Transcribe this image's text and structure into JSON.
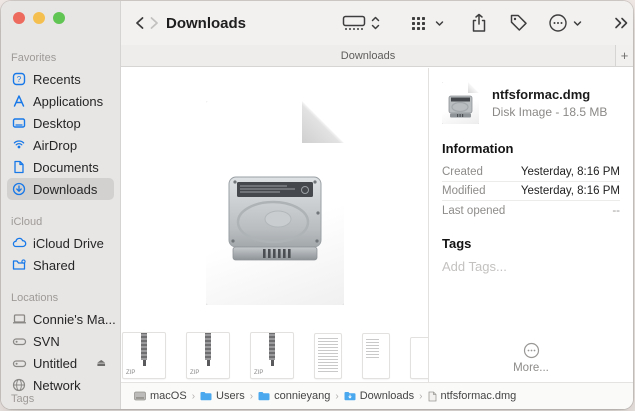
{
  "window": {
    "title": "Downloads"
  },
  "toolbar": {
    "title": "Downloads"
  },
  "tabbar": {
    "tab_label": "Downloads",
    "new_tab_label": "+"
  },
  "sidebar": {
    "sections": [
      {
        "header": "Favorites",
        "items": [
          {
            "label": "Recents",
            "icon": "recents-icon"
          },
          {
            "label": "Applications",
            "icon": "applications-icon"
          },
          {
            "label": "Desktop",
            "icon": "desktop-icon"
          },
          {
            "label": "AirDrop",
            "icon": "airdrop-icon"
          },
          {
            "label": "Documents",
            "icon": "documents-icon"
          },
          {
            "label": "Downloads",
            "icon": "downloads-icon",
            "selected": true
          }
        ]
      },
      {
        "header": "iCloud",
        "items": [
          {
            "label": "iCloud Drive",
            "icon": "icloud-icon"
          },
          {
            "label": "Shared",
            "icon": "shared-folder-icon"
          }
        ]
      },
      {
        "header": "Locations",
        "items": [
          {
            "label": "Connie's Ma...",
            "icon": "laptop-icon"
          },
          {
            "label": "SVN",
            "icon": "external-disk-icon"
          },
          {
            "label": "Untitled",
            "icon": "external-disk-icon",
            "eject": "⏏"
          },
          {
            "label": "Network",
            "icon": "globe-icon"
          }
        ]
      },
      {
        "header": "Tags",
        "items": []
      }
    ]
  },
  "inspector": {
    "filename": "ntfsformac.dmg",
    "kind_size": "Disk Image - 18.5 MB",
    "information": {
      "header": "Information",
      "rows": [
        {
          "label": "Created",
          "value": "Yesterday, 8:16 PM"
        },
        {
          "label": "Modified",
          "value": "Yesterday, 8:16 PM"
        },
        {
          "label": "Last opened",
          "value": "--"
        }
      ]
    },
    "tags": {
      "header": "Tags",
      "placeholder": "Add Tags..."
    },
    "more_label": "More..."
  },
  "strip": {
    "zip_label": "ZIP"
  },
  "pathbar": {
    "separator": "›",
    "items": [
      {
        "label": "macOS",
        "icon": "drive-icon"
      },
      {
        "label": "Users",
        "icon": "folder-icon"
      },
      {
        "label": "connieyang",
        "icon": "folder-icon"
      },
      {
        "label": "Downloads",
        "icon": "folder-icon"
      },
      {
        "label": "ntfsformac.dmg",
        "icon": "file-icon"
      }
    ]
  },
  "colors": {
    "accent_blue": "#1778e8",
    "traffic_red": "#ed6a5e",
    "traffic_yellow": "#f5bf4f",
    "traffic_green": "#61c554",
    "alert_purple": "#7a3d96"
  }
}
